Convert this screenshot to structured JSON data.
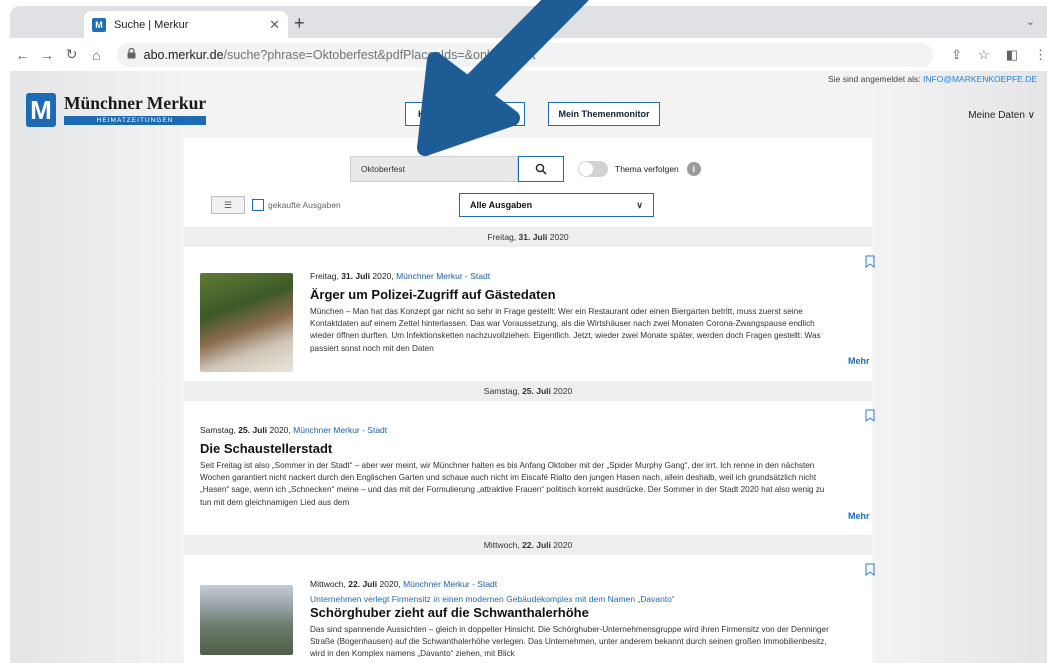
{
  "browser": {
    "tab_title": "Suche | Merkur",
    "tab_favicon": "M",
    "url_host": "abo.merkur.de",
    "url_path": "/suche?phrase=Oktoberfest&pdfPlacesIds=&onlyBought"
  },
  "header": {
    "login_prefix": "Sie sind angemeldet als:",
    "login_email": "INFO@MARKENKOEPFE.DE",
    "logo_mark": "M",
    "logo_name": "Münchner Merkur",
    "logo_sub": "HEIMATZEITUNGEN",
    "btn_kiosk_fragment": "Ki",
    "btn_monitor": "Mein Themenmonitor",
    "meine_daten": "Meine Daten"
  },
  "search": {
    "value": "Oktoberfest",
    "toggle_label": "Thema verfolgen",
    "info_glyph": "i",
    "bought_label": "gekaufte Ausgaben",
    "edition_select": "Alle Ausgaben"
  },
  "results": [
    {
      "band_day": "Freitag,",
      "band_date": "31. Juli",
      "band_year": "2020",
      "meta_day": "Freitag,",
      "meta_date": "31. Juli",
      "meta_year": "2020,",
      "source": "Münchner Merkur - Stadt",
      "headline": "Ärger um Polizei-Zugriff auf Gästedaten",
      "teaser": "München – Man hat das Konzept gar nicht so sehr in Frage gestellt: Wer ein Restaurant oder einen Biergarten betritt, muss zuerst seine Kontaktdaten auf einem Zettel hinterlassen. Das war Voraussetzung, als die Wirtshäuser nach zwei Monaten Corona-Zwangspause endlich wieder öffnen durften. Um Infektionsketten nachzuvollziehen. Eigentlich. Jetzt, wieder zwei Monate später, werden doch Fragen gestellt: Was passiert sonst noch mit den Daten",
      "more": "Mehr"
    },
    {
      "band_day": "Samstag,",
      "band_date": "25. Juli",
      "band_year": "2020",
      "meta_day": "Samstag,",
      "meta_date": "25. Juli",
      "meta_year": "2020,",
      "source": "Münchner Merkur - Stadt",
      "headline": "Die Schaustellerstadt",
      "teaser": "Seit Freitag ist also „Sommer in der Stadt“ – aber wer meint, wir Münchner halten es bis Anfang Oktober mit der „Spider Murphy Gang“, der irrt. Ich renne in den nächsten Wochen garantiert nicht nackert durch den Englischen Garten und schaue auch nicht im Eiscafé Rialto den jungen Hasen nach, allein deshalb, weil ich grundsätzlich nicht „Hasen“ sage, wenn ich „Schnecken“ meine – und das mit der Formulierung „attraktive Frauen“ politisch korrekt ausdrücke. Der Sommer in der Stadt 2020 hat also wenig zu tun mit dem gleichnamigen Lied aus dem",
      "more": "Mehr"
    },
    {
      "band_day": "Mittwoch,",
      "band_date": "22. Juli",
      "band_year": "2020",
      "meta_day": "Mittwoch,",
      "meta_date": "22. Juli",
      "meta_year": "2020,",
      "source": "Münchner Merkur - Stadt",
      "kicker": "Unternehmen verlegt Firmensitz in einen modernen Gebäudekomplex mit dem Namen „Davanto“",
      "headline": "Schörghuber zieht auf die Schwanthalerhöhe",
      "teaser": "Das sind spannende Aussichten – gleich in doppelter Hinsicht. Die Schörghuber-Unternehmensgruppe wird ihren Firmensitz von der Denninger Straße (Bogenhausen) auf die Schwanthalerhöhe verlegen. Das Unternehmen, unter anderem bekannt durch seinen großen Immobilienbesitz, wird in den Komplex namens „Davanto“ ziehen, mit Blick"
    }
  ],
  "colors": {
    "brand_blue": "#1d6bb5",
    "arrow_blue": "#1e5c96"
  }
}
